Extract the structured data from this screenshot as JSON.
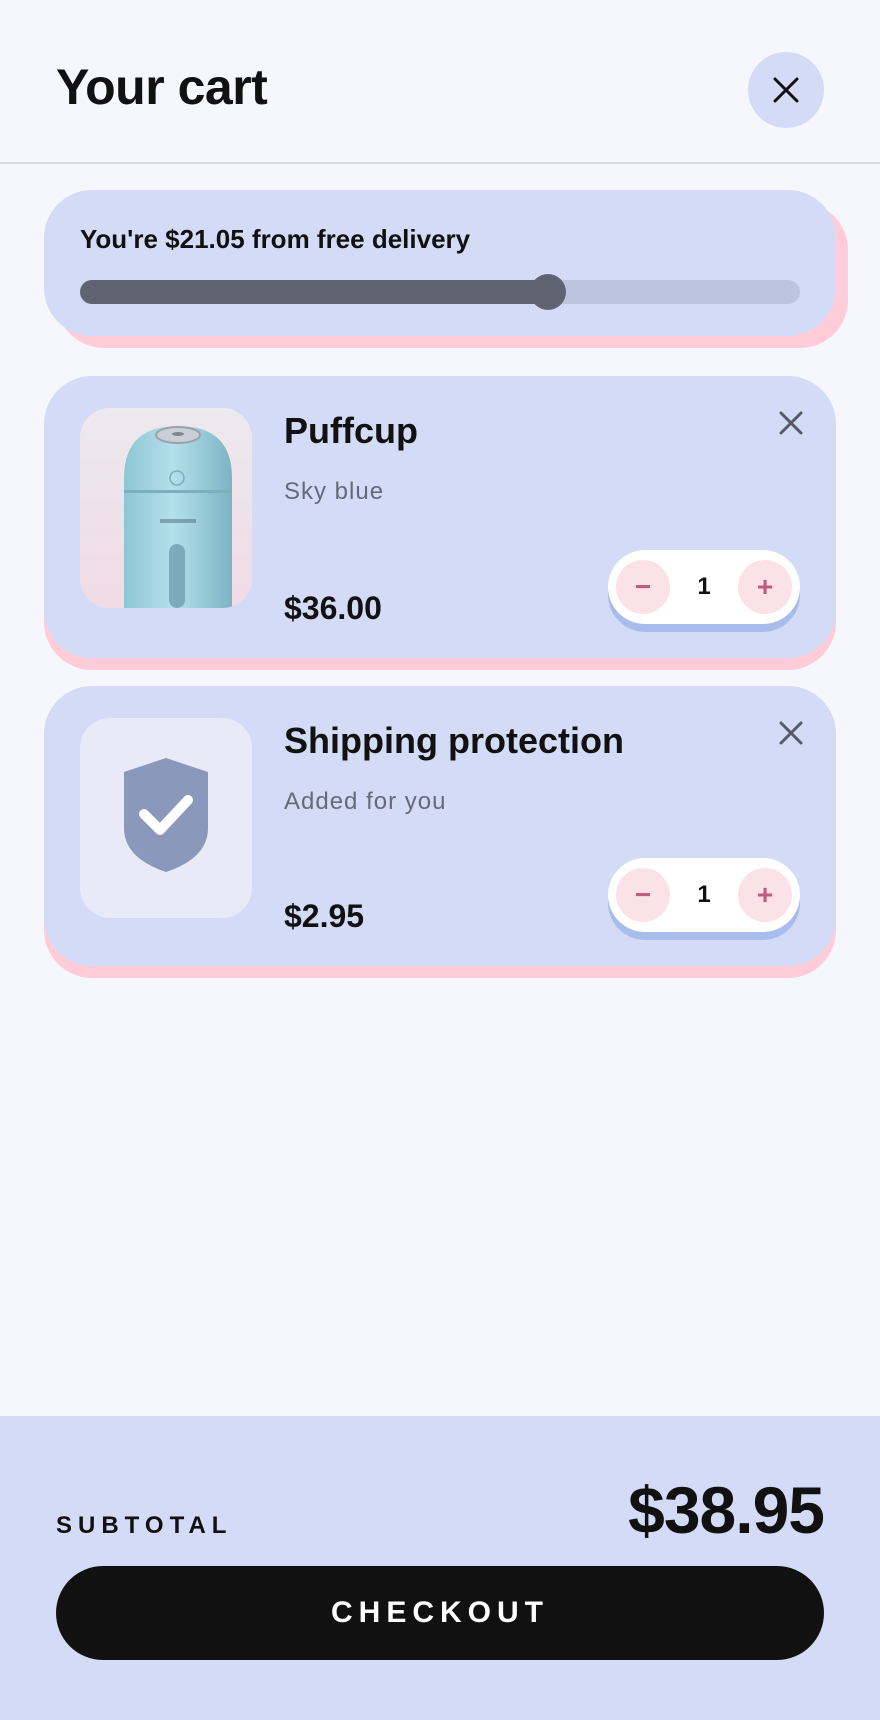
{
  "header": {
    "title": "Your cart"
  },
  "delivery": {
    "message": "You're $21.05 from free delivery",
    "progress": 0.65
  },
  "items": [
    {
      "name": "Puffcup",
      "variant": "Sky blue",
      "price": "$36.00",
      "quantity": "1"
    },
    {
      "name": "Shipping protection",
      "variant": "Added for you",
      "price": "$2.95",
      "quantity": "1"
    }
  ],
  "stepper": {
    "minus": "−",
    "plus": "+"
  },
  "footer": {
    "subtotal_label": "SUBTOTAL",
    "subtotal_value": "$38.95",
    "checkout_label": "CHECKOUT"
  },
  "colors": {
    "card": "#d3dbf6",
    "card_shadow": "#ffccd8",
    "stepper_accent": "#c05a7e",
    "checkout_bg": "#111111"
  }
}
